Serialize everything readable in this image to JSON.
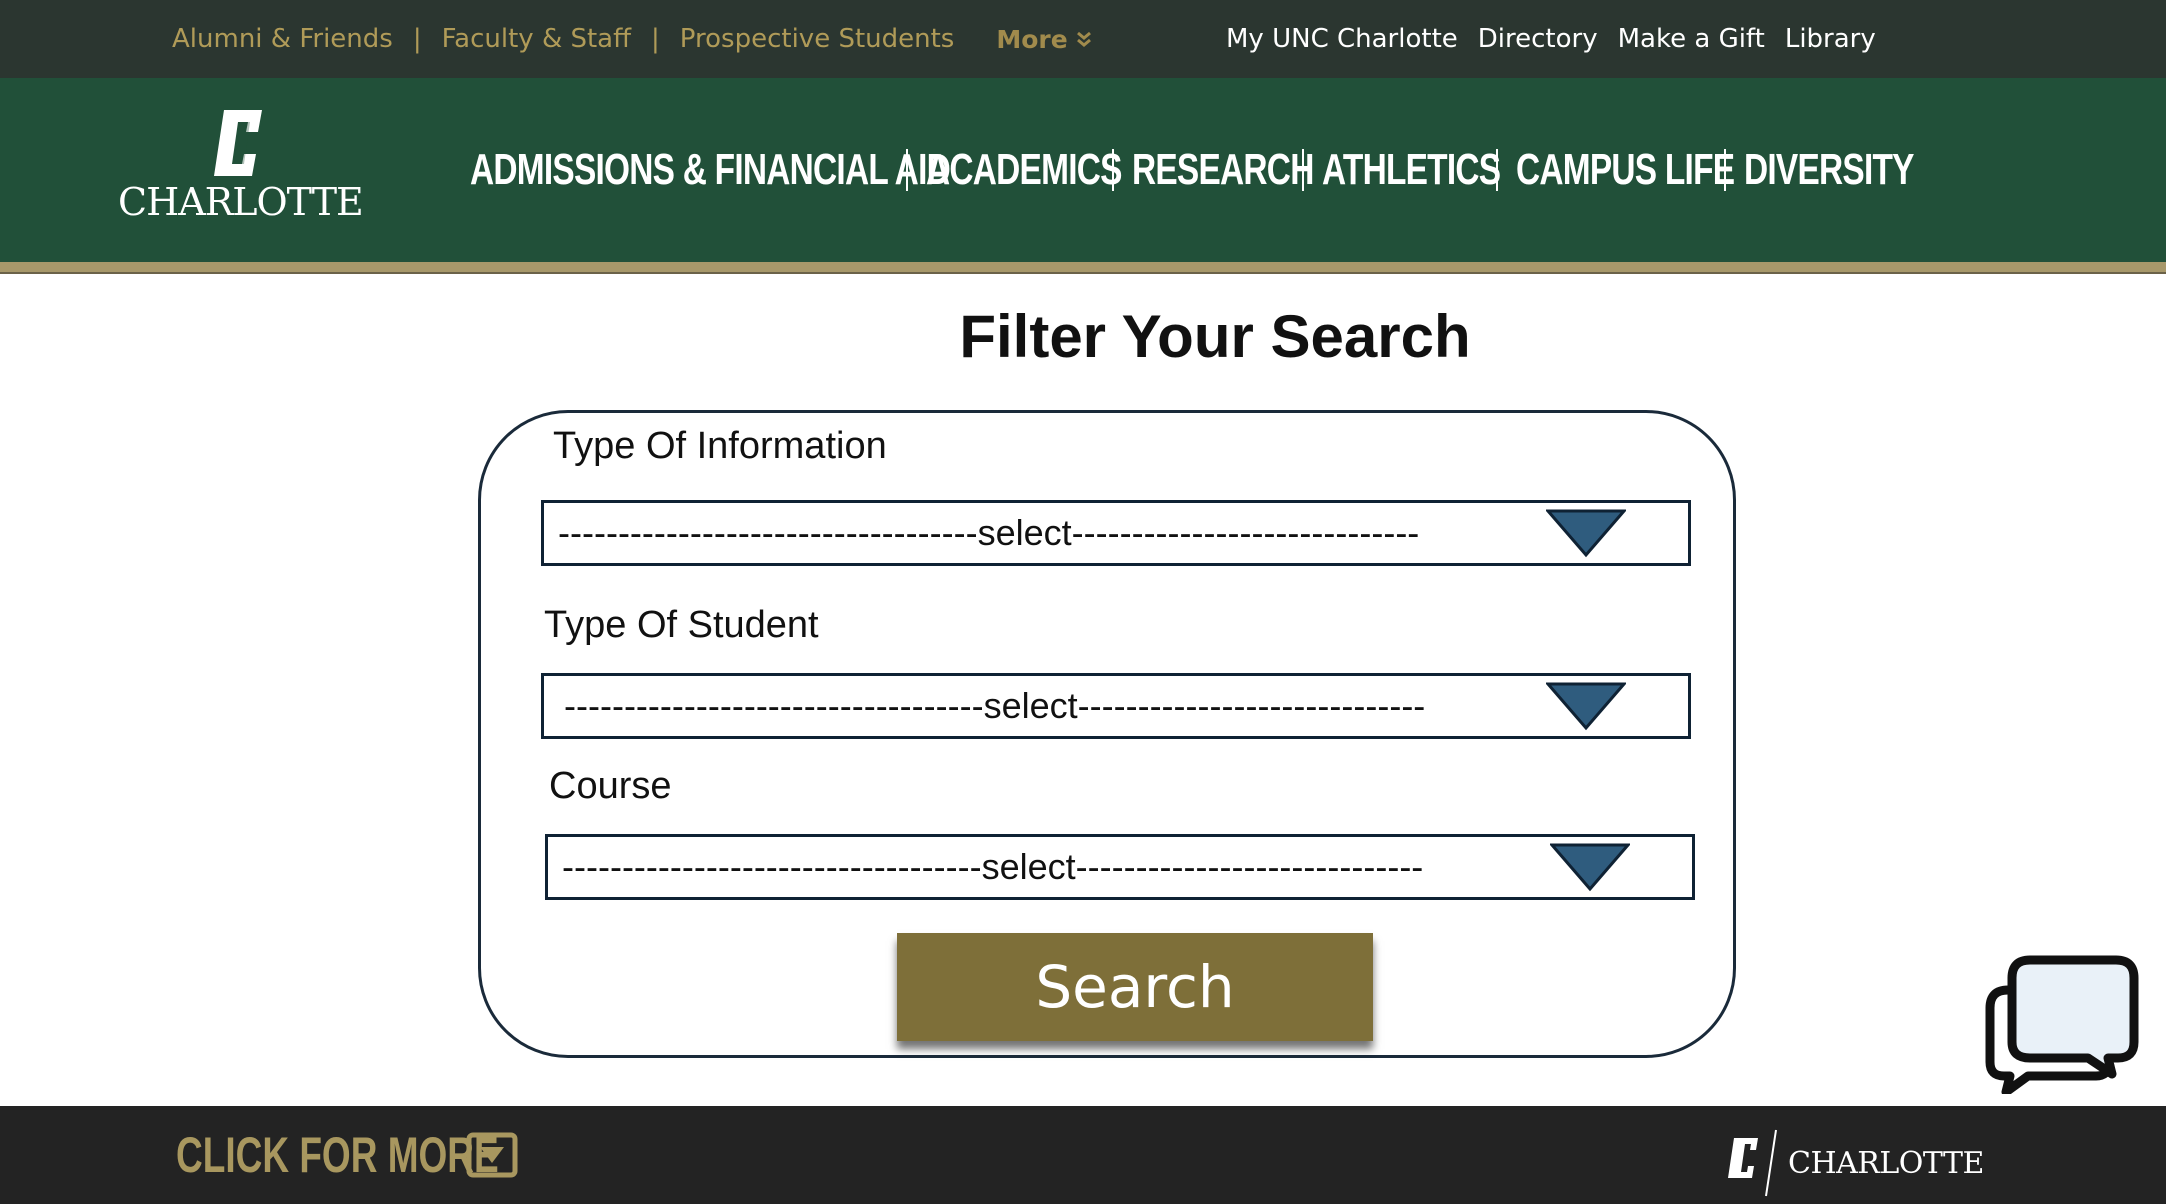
{
  "utility_nav": {
    "left_links": [
      "Alumni & Friends",
      "Faculty & Staff",
      "Prospective Students"
    ],
    "more_label": "More",
    "right_links": [
      "My UNC Charlotte",
      "Directory",
      "Make a Gift",
      "Library"
    ]
  },
  "header": {
    "logo_text": "CHARLOTTE",
    "nav_items": [
      "ADMISSIONS & FINANCIAL AID",
      "ACADEMICS",
      "RESEARCH",
      "ATHLETICS",
      "CAMPUS LIFE",
      "DIVERSITY"
    ]
  },
  "filter": {
    "title": "Filter Your Search",
    "fields": [
      {
        "label": "Type Of Information",
        "value": "-----------------------------------select-----------------------------"
      },
      {
        "label": "Type Of Student",
        "value": "-----------------------------------select-----------------------------"
      },
      {
        "label": "Course",
        "value": "-----------------------------------select-----------------------------"
      }
    ],
    "search_label": "Search"
  },
  "footer": {
    "click_more_label": "CLICK FOR MORE",
    "logo_text": "CHARLOTTE"
  },
  "colors": {
    "utility_bg": "#2b3630",
    "header_green": "#215039",
    "gold": "#a7986a",
    "button_gold": "#7e6f39",
    "arrow_blue": "#2f5c7e",
    "footer_bg": "#232323"
  }
}
